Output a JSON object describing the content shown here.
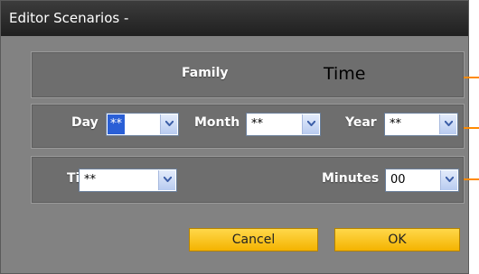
{
  "window": {
    "title": "Editor Scenarios -"
  },
  "header_row": {
    "family_label": "Family",
    "type_value": "Time"
  },
  "date_row": {
    "day_label": "Day",
    "day_value": "**",
    "month_label": "Month",
    "month_value": "**",
    "year_label": "Year",
    "year_value": "**"
  },
  "time_row": {
    "time_label": "Time",
    "time_value": "**",
    "minutes_label": "Minutes",
    "minutes_value": "00"
  },
  "buttons": {
    "cancel_label": "Cancel",
    "ok_label": "OK"
  },
  "colors": {
    "accent_tick": "#ff8a00",
    "button": "#f4b300",
    "selected_value": "#2a5fd6"
  }
}
